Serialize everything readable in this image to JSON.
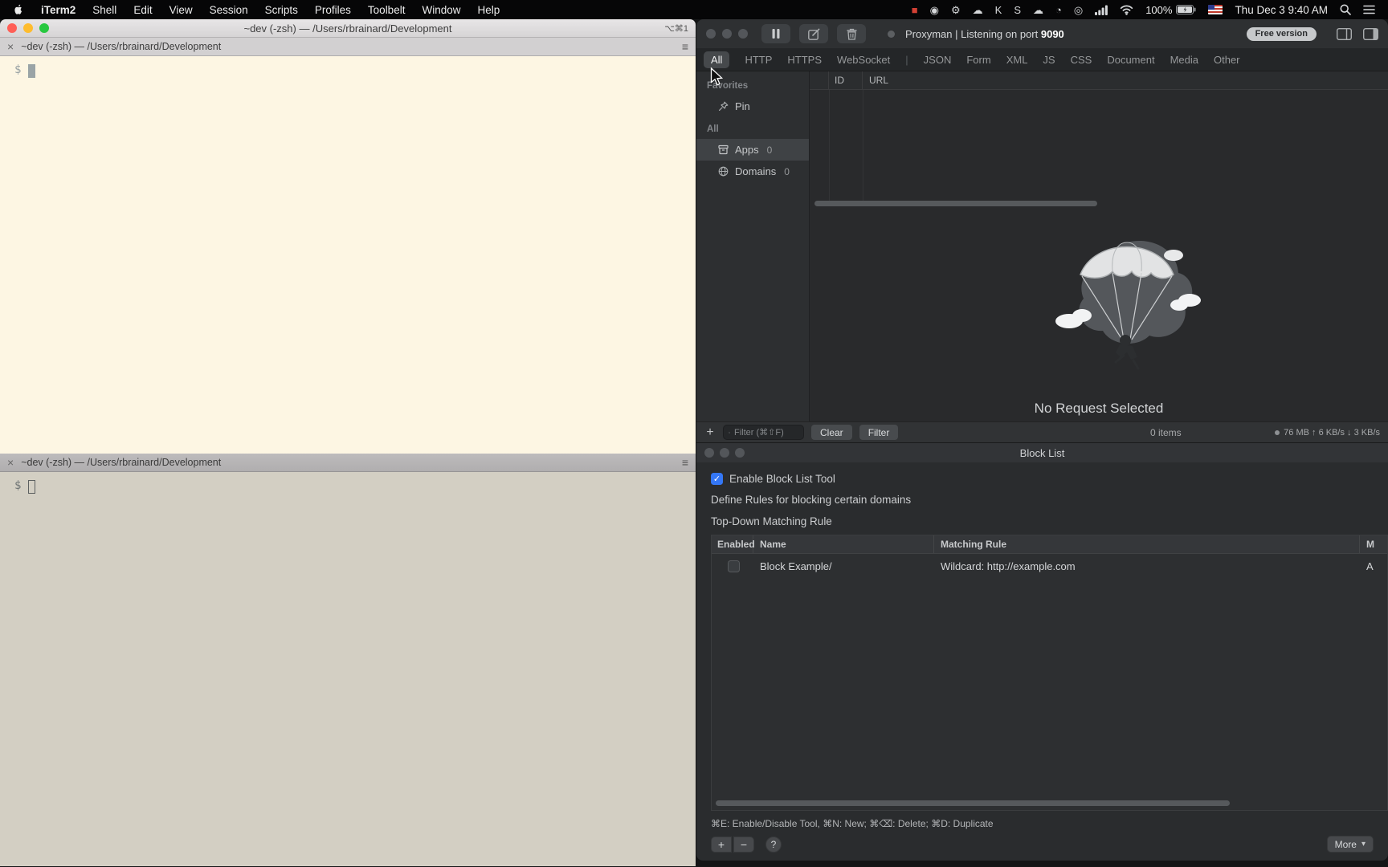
{
  "menu_bar": {
    "app_name": "iTerm2",
    "menus": [
      "Shell",
      "Edit",
      "View",
      "Session",
      "Scripts",
      "Profiles",
      "Toolbelt",
      "Window",
      "Help"
    ],
    "status_icons": [
      {
        "name": "record-app-icon",
        "glyph": "■"
      },
      {
        "name": "camera-app-icon",
        "glyph": "◉"
      },
      {
        "name": "gear-app-icon",
        "glyph": "⚙"
      },
      {
        "name": "cloud-app-icon",
        "glyph": "☁"
      },
      {
        "name": "k-app-icon",
        "glyph": "K"
      },
      {
        "name": "s-app-icon",
        "glyph": "S"
      },
      {
        "name": "cloud-sync-app-icon",
        "glyph": "☁"
      },
      {
        "name": "clock-app-icon",
        "glyph": "◔"
      },
      {
        "name": "target-app-icon",
        "glyph": "◎"
      }
    ],
    "battery_percent": "100%",
    "clock": "Thu Dec 3  9:40 AM"
  },
  "terminal_top": {
    "window_title": "~dev (-zsh) — /Users/rbrainard/Development",
    "window_shortcut": "⌥⌘1",
    "tab_close": "×",
    "tab_menu": "≡",
    "tab_title": "~dev (-zsh) — /Users/rbrainard/Development",
    "prompt": "$"
  },
  "terminal_bottom": {
    "tab_close": "×",
    "tab_menu": "≡",
    "tab_title": "~dev (-zsh) — /Users/rbrainard/Development",
    "prompt": "$"
  },
  "proxyman": {
    "title_prefix": "Proxyman | Listening on port ",
    "port": "9090",
    "badge": "Free version",
    "protocol_tabs": [
      "All",
      "HTTP",
      "HTTPS",
      "WebSocket"
    ],
    "tabs_separator": "|",
    "content_tabs": [
      "JSON",
      "Form",
      "XML",
      "JS",
      "CSS",
      "Document",
      "Media",
      "Other"
    ],
    "sidebar": {
      "favorites_label": "Favorites",
      "pin_label": "Pin",
      "all_label": "All",
      "apps_label": "Apps",
      "apps_count": "0",
      "domains_label": "Domains",
      "domains_count": "0"
    },
    "table": {
      "col_id": "ID",
      "col_url": "URL"
    },
    "empty_state": "No Request Selected",
    "toolbar": {
      "add": "+",
      "filter_placeholder": "Filter (⌘⇧F)",
      "clear": "Clear",
      "filter": "Filter",
      "items": "0 items",
      "stats": "76 MB ↑ 6 KB/s ↓ 3 KB/s"
    },
    "accent_colors": {
      "window_bg": "#28292b",
      "selection": "#3f4245"
    }
  },
  "block_list": {
    "title": "Block List",
    "enable_label": "Enable Block List Tool",
    "description": "Define Rules for blocking certain domains",
    "matching_label": "Top-Down Matching Rule",
    "table": {
      "col_enabled": "Enabled",
      "col_name": "Name",
      "col_rule": "Matching Rule",
      "col_method": "M",
      "rows": [
        {
          "name": "Block Example/",
          "rule": "Wildcard: http://example.com",
          "method": "A"
        }
      ]
    },
    "shortcuts": "⌘E: Enable/Disable Tool, ⌘N: New; ⌘⌫: Delete; ⌘D: Duplicate",
    "add": "+",
    "remove": "−",
    "help": "?",
    "more": "More",
    "more_chevron": "▾",
    "checkbox_color": "#3477f6"
  }
}
